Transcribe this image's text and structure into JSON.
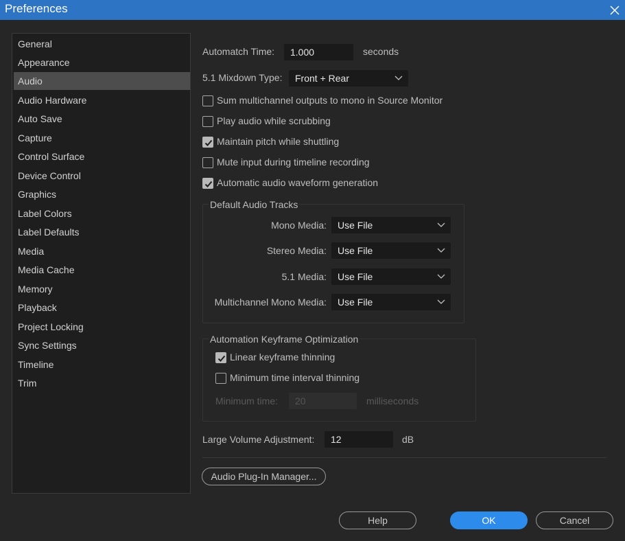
{
  "window": {
    "title": "Preferences"
  },
  "sidebar": {
    "items": [
      "General",
      "Appearance",
      "Audio",
      "Audio Hardware",
      "Auto Save",
      "Capture",
      "Control Surface",
      "Device Control",
      "Graphics",
      "Label Colors",
      "Label Defaults",
      "Media",
      "Media Cache",
      "Memory",
      "Playback",
      "Project Locking",
      "Sync Settings",
      "Timeline",
      "Trim"
    ],
    "selected": "Audio"
  },
  "audio": {
    "automatch_label": "Automatch Time:",
    "automatch_value": "1.000",
    "automatch_unit": "seconds",
    "mixdown_label": "5.1 Mixdown Type:",
    "mixdown_value": "Front + Rear",
    "checkboxes": [
      {
        "label": "Sum multichannel outputs to mono in Source Monitor",
        "checked": false
      },
      {
        "label": "Play audio while scrubbing",
        "checked": false
      },
      {
        "label": "Maintain pitch while shuttling",
        "checked": true
      },
      {
        "label": "Mute input during timeline recording",
        "checked": false
      },
      {
        "label": "Automatic audio waveform generation",
        "checked": true
      }
    ],
    "default_tracks": {
      "title": "Default Audio Tracks",
      "rows": [
        {
          "label": "Mono Media:",
          "value": "Use File"
        },
        {
          "label": "Stereo Media:",
          "value": "Use File"
        },
        {
          "label": "5.1 Media:",
          "value": "Use File"
        },
        {
          "label": "Multichannel Mono Media:",
          "value": "Use File"
        }
      ]
    },
    "keyframe": {
      "title": "Automation Keyframe Optimization",
      "linear": {
        "label": "Linear keyframe thinning",
        "checked": true
      },
      "minimum": {
        "label": "Minimum time interval thinning",
        "checked": false
      },
      "min_time_label": "Minimum time:",
      "min_time_value": "20",
      "min_time_unit": "milliseconds"
    },
    "volume_label": "Large Volume Adjustment:",
    "volume_value": "12",
    "volume_unit": "dB",
    "plugin_button": "Audio Plug-In Manager..."
  },
  "footer": {
    "help": "Help",
    "ok": "OK",
    "cancel": "Cancel"
  },
  "colors": {
    "titlebar": "#2d74c4",
    "primary": "#2d8ceb",
    "background": "#262626"
  }
}
